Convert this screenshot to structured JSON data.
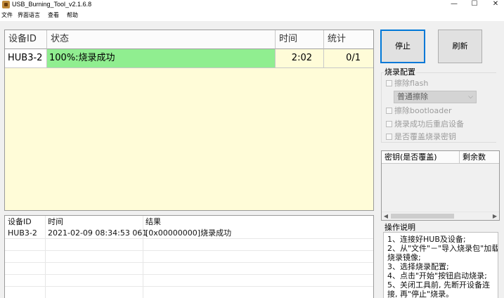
{
  "window": {
    "title": "USB_Burning_Tool_v2.1.6.8",
    "controls": {
      "minimize": "—",
      "maximize": "☐",
      "close": "✕"
    }
  },
  "menu": [
    "文件",
    "界面语言",
    "查看",
    "帮助"
  ],
  "device_table": {
    "headers": {
      "device_id": "设备ID",
      "status": "状态",
      "time": "时间",
      "stats": "统计"
    },
    "rows": [
      {
        "device_id": "HUB3-2",
        "status": "100%:烧录成功",
        "time": "2:02",
        "stats": "0/1",
        "status_color": "#90ee90"
      }
    ],
    "background_color": "#fffcd8"
  },
  "buttons": {
    "stop": "停止",
    "refresh": "刷新"
  },
  "burn_config": {
    "title": "烧录配置",
    "erase_flash": "擦除flash",
    "erase_mode": "普通擦除",
    "erase_bootloader": "擦除bootloader",
    "reboot_after_success": "烧录成功后重启设备",
    "overwrite_key": "是否覆盖烧录密钥"
  },
  "key_table": {
    "col_key": "密钥(是否覆盖)",
    "col_remaining": "剩余数"
  },
  "help": {
    "title": "操作说明",
    "lines": [
      "1、连接好HUB及设备;",
      "2、从\"文件\"－\"导入烧录包\"加载",
      "烧录镜像;",
      "3、选择烧录配置;",
      "4、点击\"开始\"按钮启动烧录;",
      "5、关闭工具前, 先断开设备连",
      "接, 再\"停止\"烧录。"
    ]
  },
  "log": {
    "headers": {
      "device_id": "设备ID",
      "time": "时间",
      "result": "结果"
    },
    "rows": [
      {
        "device_id": "HUB3-2",
        "time": "2021-02-09 08:34:53 061",
        "result": "[0x00000000]烧录成功"
      }
    ]
  }
}
